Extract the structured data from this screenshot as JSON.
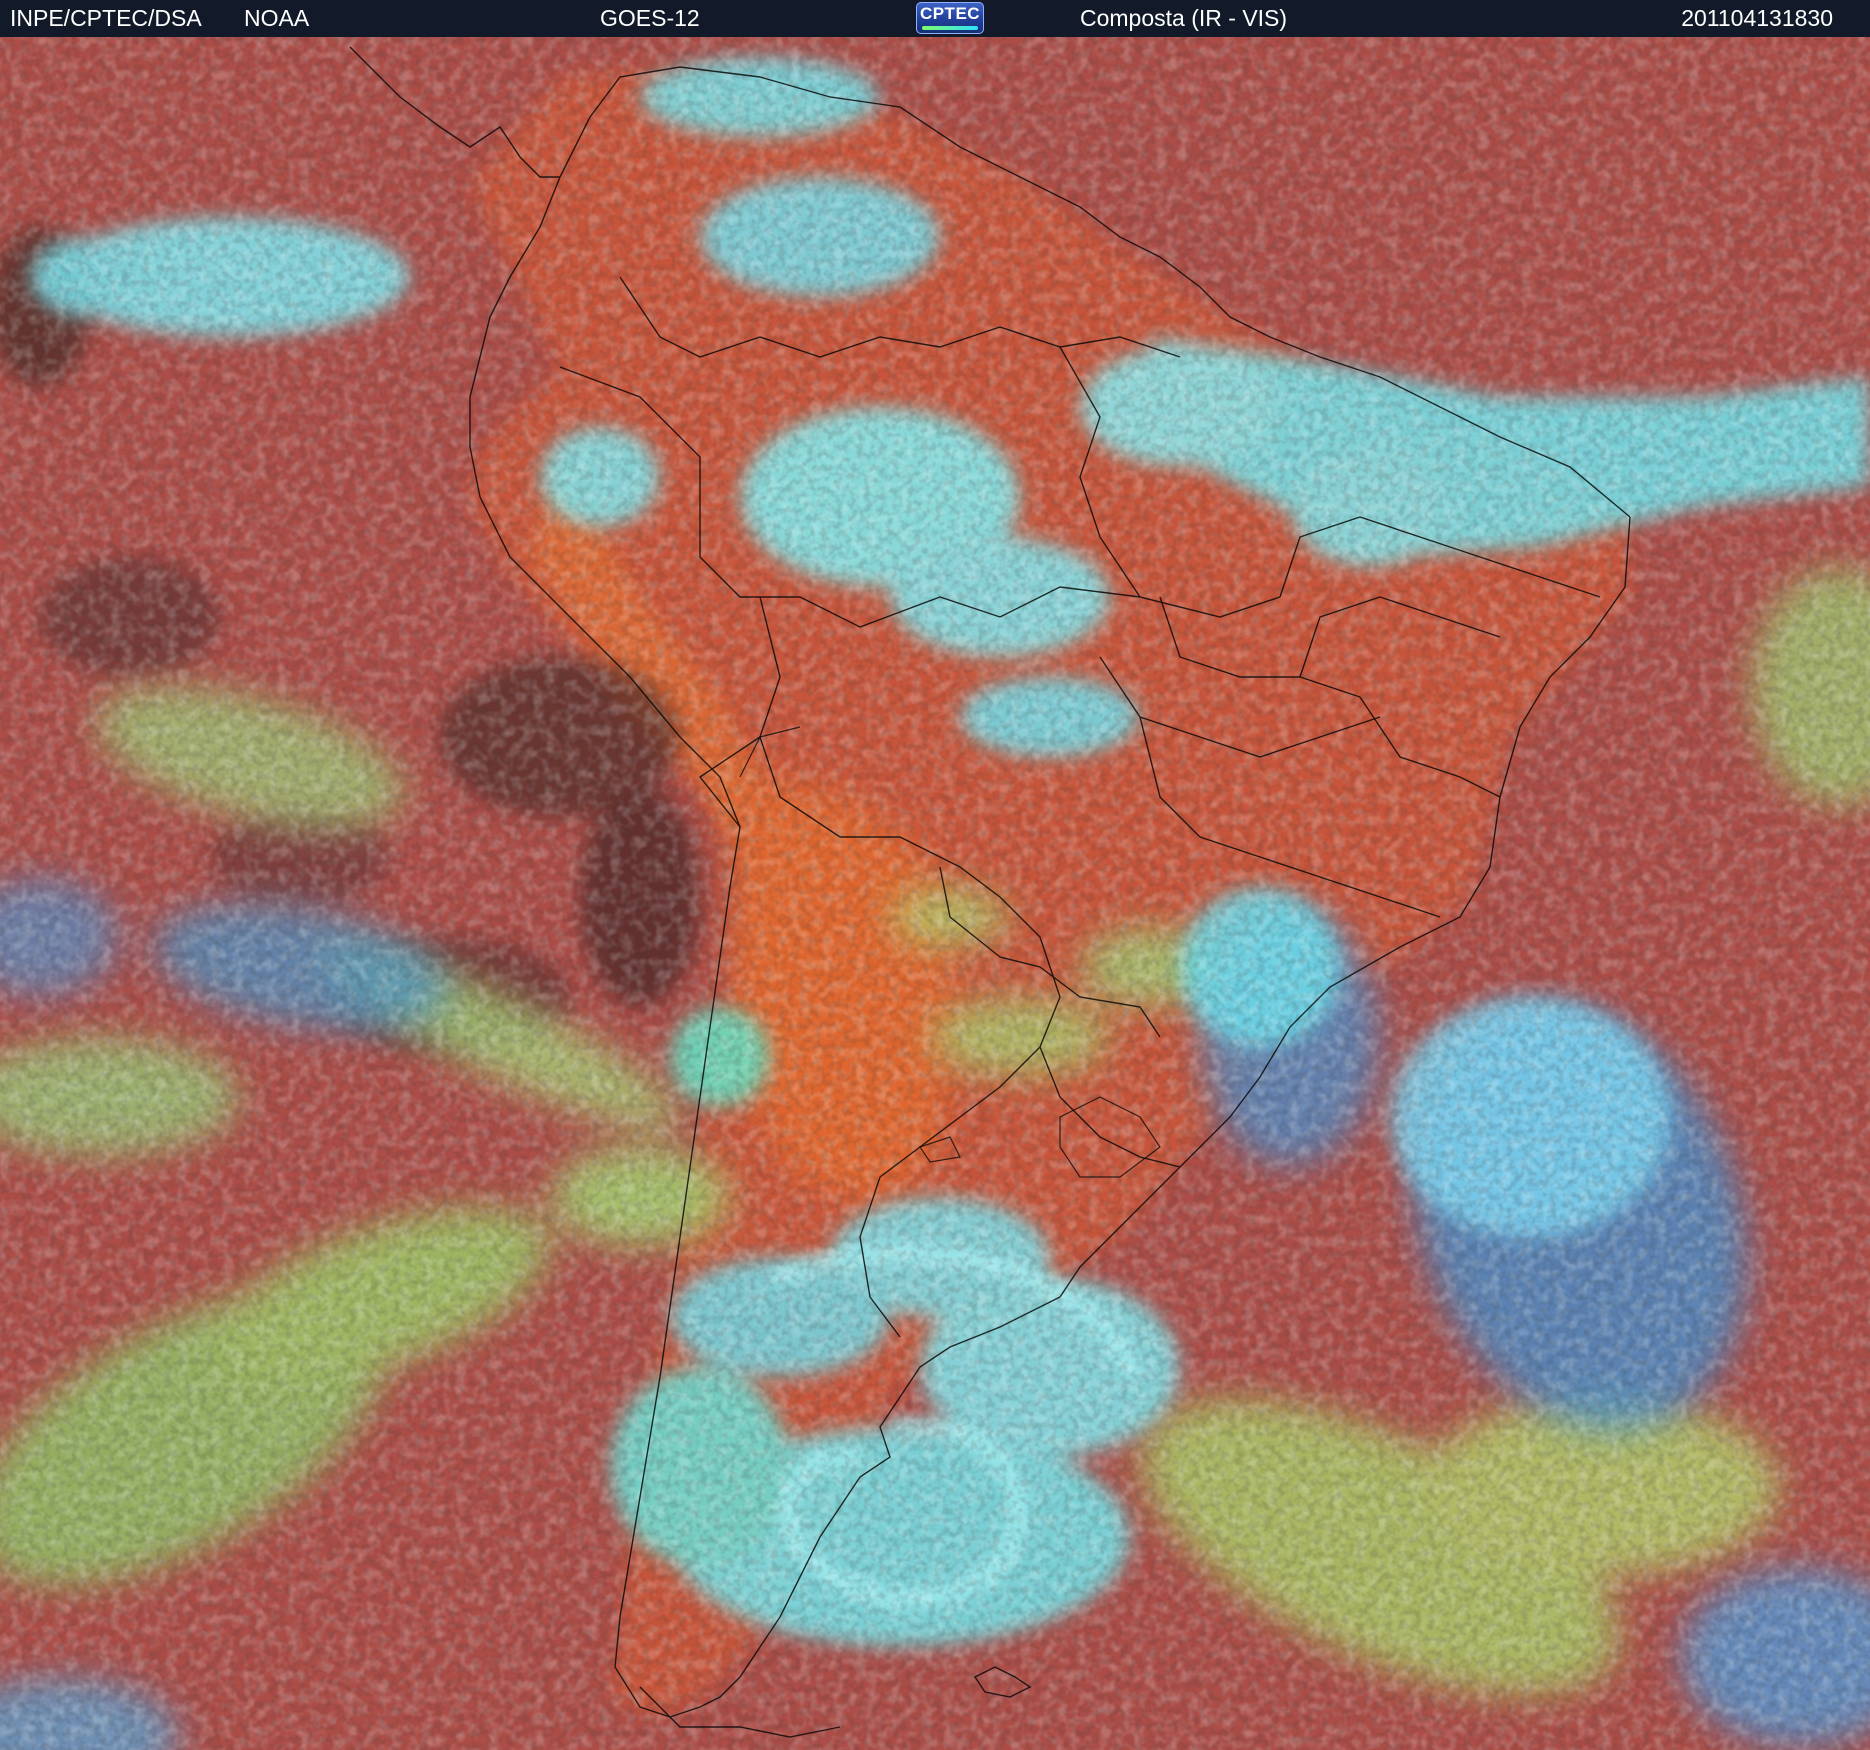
{
  "header": {
    "agency": "INPE/CPTEC/DSA",
    "partner": "NOAA",
    "satellite": "GOES-12",
    "product": "Composta (IR - VIS)",
    "timestamp": "201104131830",
    "logo_text": "CPTEC"
  },
  "colors": {
    "header_bg": "#121a29",
    "ocean_red": "#a84a45",
    "land_orange": "#d2603a",
    "high_cloud_cyan": "#6ee8f2",
    "mid_cloud_green": "#9edc6a",
    "low_cloud_blue": "#3d9ad8",
    "borders": "#000000"
  },
  "image": {
    "description_icon": "satellite-composite-imagery",
    "region": ""
  }
}
